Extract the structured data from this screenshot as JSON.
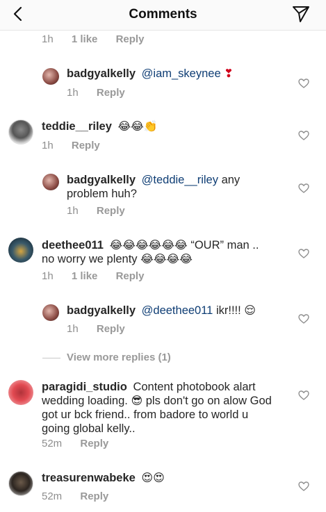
{
  "header": {
    "title": "Comments"
  },
  "top_meta": {
    "time": "1h",
    "likes": "1 like",
    "reply": "Reply"
  },
  "comments": [
    {
      "user": "badgyalkelly",
      "mention": "@iam_skeynee",
      "text": "",
      "emoji": "❣",
      "time": "1h",
      "reply": "Reply"
    },
    {
      "user": "teddie__riley",
      "text": "",
      "emoji": "😂😂👏",
      "time": "1h",
      "reply": "Reply"
    },
    {
      "user": "badgyalkelly",
      "mention": "@teddie__riley",
      "text": "any problem huh?",
      "time": "1h",
      "reply": "Reply"
    },
    {
      "user": "deethee011",
      "line1_emoji": "😂😂😂😂😂😂",
      "line1_text": "“OUR” man ..",
      "line2_text": "no worry we plenty",
      "line2_emoji": "😂😂😂😂",
      "time": "1h",
      "likes": "1 like",
      "reply": "Reply"
    },
    {
      "user": "badgyalkelly",
      "mention": "@deethee011",
      "text": "ikr!!!!",
      "emoji": "😌",
      "time": "1h",
      "reply": "Reply"
    },
    {
      "user": "paragidi_studio",
      "line1": "Content photobook alart",
      "line2_a": "wedding loading.",
      "line2_emoji": "😎",
      "line2_b": "pls don't go on alow God",
      "line3": "got ur bck friend.. from badore to world u",
      "line4": "going global kelly..",
      "time": "52m",
      "reply": "Reply"
    },
    {
      "user": "treasurenwabeke",
      "emoji": "😍😍",
      "time": "52m",
      "reply": "Reply"
    }
  ],
  "view_more": "View more replies (1)"
}
